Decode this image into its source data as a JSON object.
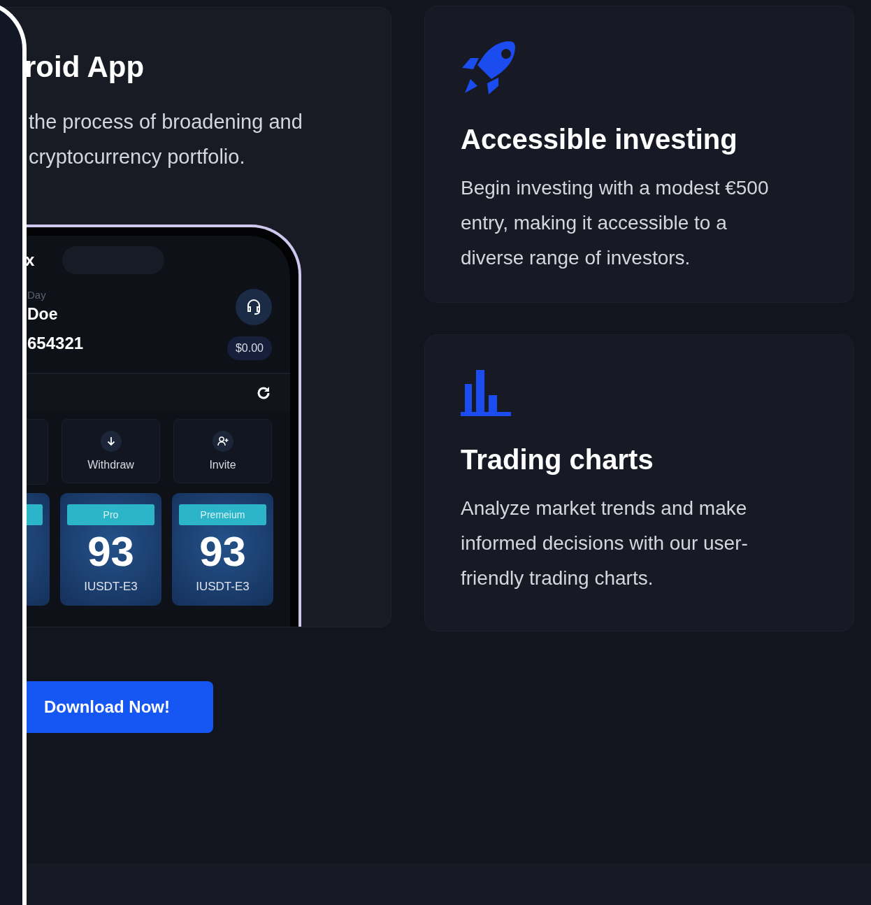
{
  "promo_card": {
    "title": "roid App",
    "description": "the process of broadening and cryptocurrency portfolio.",
    "phone": {
      "top_glyph": "x",
      "greeting": "Day",
      "name": "Doe",
      "account": "654321",
      "balance": "$0.00",
      "actions": [
        {
          "kind": "withdraw",
          "label": "Withdraw"
        },
        {
          "kind": "invite",
          "label": "Invite"
        }
      ],
      "plans": [
        {
          "tier": "Pro",
          "value": "93",
          "unit": "IUSDT-E3"
        },
        {
          "tier": "Premeium",
          "value": "93",
          "unit": "IUSDT-E3"
        }
      ]
    }
  },
  "download_button": "Download Now!",
  "features": [
    {
      "kind": "investing",
      "title": "Accessible investing",
      "description": "Begin investing with a modest €500 entry, making it accessible to a diverse range of investors."
    },
    {
      "kind": "charts",
      "title": "Trading charts",
      "description": "Analyze market trends and make informed decisions with our user-friendly trading charts."
    }
  ]
}
